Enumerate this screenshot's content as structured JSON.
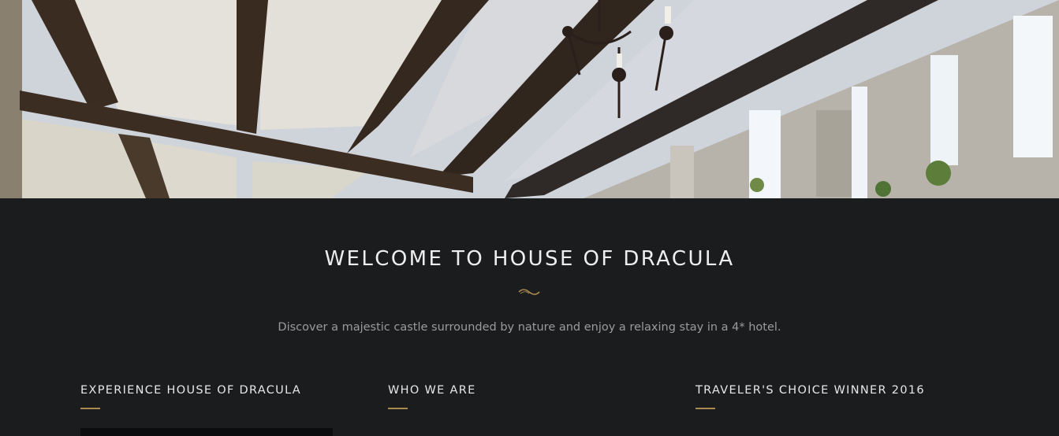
{
  "hero": {
    "image_description_icon": "castle-ceiling-photo"
  },
  "welcome": {
    "title": "WELCOME TO HOUSE OF DRACULA",
    "subtitle": "Discover a majestic castle surrounded by nature and enjoy a relaxing stay in a 4* hotel."
  },
  "columns": [
    {
      "heading": "EXPERIENCE HOUSE OF DRACULA"
    },
    {
      "heading": "WHO WE ARE"
    },
    {
      "heading": "TRAVELER'S CHOICE WINNER 2016"
    }
  ],
  "colors": {
    "background": "#1b1c1e",
    "accent_gold": "#a98a50",
    "heading_text": "#eeeeee",
    "body_text": "#9b9b9b"
  }
}
